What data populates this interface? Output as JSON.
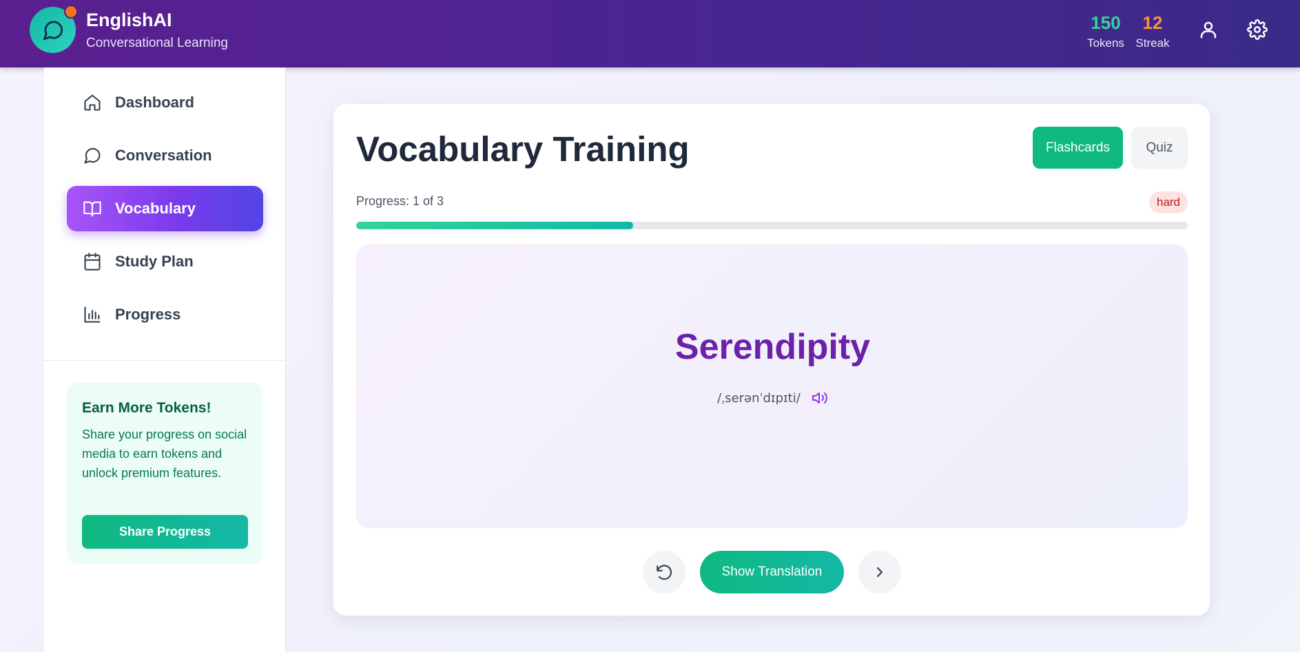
{
  "header": {
    "app_name": "EnglishAI",
    "tagline": "Conversational Learning",
    "tokens": {
      "value": "150",
      "label": "Tokens"
    },
    "streak": {
      "value": "12",
      "label": "Streak"
    },
    "icons": [
      "chat-bubble-icon",
      "user-icon",
      "gear-icon"
    ]
  },
  "sidebar": {
    "items": [
      {
        "label": "Dashboard",
        "icon": "home-icon"
      },
      {
        "label": "Conversation",
        "icon": "chat-icon"
      },
      {
        "label": "Vocabulary",
        "icon": "book-icon",
        "active": true
      },
      {
        "label": "Study Plan",
        "icon": "calendar-icon"
      },
      {
        "label": "Progress",
        "icon": "bar-chart-icon"
      }
    ],
    "promo": {
      "title": "Earn More Tokens!",
      "text": "Share your progress on social media to earn tokens and unlock premium features.",
      "button": "Share Progress"
    }
  },
  "main": {
    "title": "Vocabulary Training",
    "modes": {
      "flashcards": "Flashcards",
      "quiz": "Quiz",
      "active": "Flashcards"
    },
    "progress": {
      "label": "Progress: 1 of 3",
      "current": 1,
      "total": 3,
      "fraction": 0.3333
    },
    "difficulty": "hard",
    "card": {
      "word": "Serendipity",
      "pronunciation": "/ˌserənˈdɪpɪti/"
    },
    "actions": {
      "show_translation": "Show Translation"
    }
  },
  "colors": {
    "header_start": "#5b1f8f",
    "header_end": "#3b2a88",
    "accent_green": "#10b981",
    "active_nav_start": "#a855f7",
    "active_nav_end": "#4f46e5",
    "word_purple": "#6b21a8",
    "tokens_color": "#34d399",
    "streak_color": "#fb923c"
  }
}
